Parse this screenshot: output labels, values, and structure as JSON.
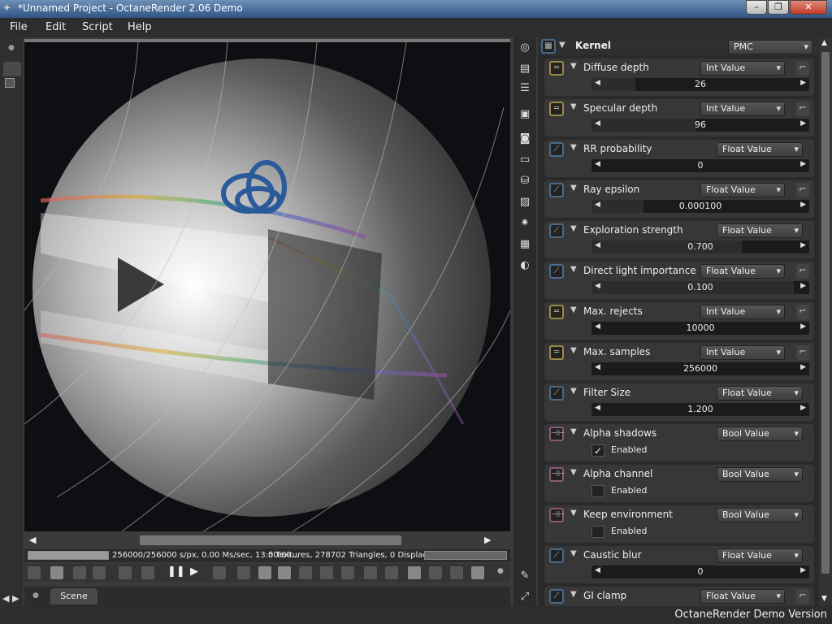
{
  "window": {
    "title": "*Unnamed Project - OctaneRender 2.06 Demo"
  },
  "menu": [
    "File",
    "Edit",
    "Script",
    "Help"
  ],
  "status": {
    "samples": "256000/256000 s/px, 0.00 Ms/sec, 13:50:09...",
    "scene_stats": "0 Textures, 278702 Triangles, 0 Displacemen..."
  },
  "scene_tab": "Scene",
  "footer": "OctaneRender Demo Version",
  "kernel": {
    "label": "Kernel",
    "type": "PMC"
  },
  "params": [
    {
      "label": "Diffuse depth",
      "type": "Int Value",
      "kind": "int",
      "value": "26",
      "fraction": 0.2,
      "link": true
    },
    {
      "label": "Specular depth",
      "type": "Int Value",
      "kind": "int",
      "value": "96",
      "fraction": 0.48,
      "link": true
    },
    {
      "label": "RR probability",
      "type": "Float Value",
      "kind": "float",
      "value": "0",
      "fraction": 0,
      "link": false
    },
    {
      "label": "Ray epsilon",
      "type": "Float Value",
      "kind": "float",
      "value": "0.000100",
      "fraction": 0.24,
      "link": true
    },
    {
      "label": "Exploration strength",
      "type": "Float Value",
      "kind": "float",
      "value": "0.700",
      "fraction": 0.69,
      "link": false
    },
    {
      "label": "Direct light importance",
      "type": "Float Value",
      "kind": "float",
      "value": "0.100",
      "fraction": 0.93,
      "link": true
    },
    {
      "label": "Max. rejects",
      "type": "Int Value",
      "kind": "int",
      "value": "10000",
      "fraction": 0,
      "link": true
    },
    {
      "label": "Max. samples",
      "type": "Int Value",
      "kind": "int",
      "value": "256000",
      "fraction": 0,
      "link": true
    },
    {
      "label": "Filter Size",
      "type": "Float Value",
      "kind": "float",
      "value": "1.200",
      "fraction": 0,
      "link": false
    },
    {
      "label": "Alpha shadows",
      "type": "Bool Value",
      "kind": "bool",
      "checked": true,
      "check_label": "Enabled",
      "link": false
    },
    {
      "label": "Alpha channel",
      "type": "Bool Value",
      "kind": "bool",
      "checked": false,
      "check_label": "Enabled",
      "link": false
    },
    {
      "label": "Keep environment",
      "type": "Bool Value",
      "kind": "bool",
      "checked": false,
      "check_label": "Enabled",
      "link": false
    },
    {
      "label": "Caustic blur",
      "type": "Float Value",
      "kind": "float",
      "value": "0",
      "fraction": 0,
      "link": false
    },
    {
      "label": "GI clamp",
      "type": "Float Value",
      "kind": "float",
      "value": "",
      "fraction": 0,
      "link": true
    }
  ]
}
